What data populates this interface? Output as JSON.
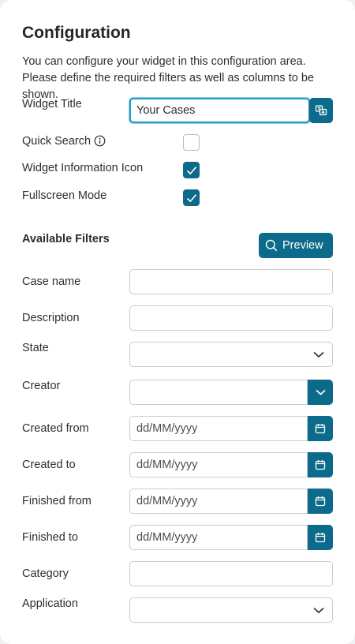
{
  "header": {
    "title": "Configuration",
    "description": "You can configure your widget in this configuration area. Please define the required filters as well as columns to be shown."
  },
  "settings": {
    "widget_title_label": "Widget Title",
    "widget_title_value": "Your Cases",
    "quick_search_label": "Quick Search",
    "quick_search_checked": false,
    "info_icon_label": "Widget Information Icon",
    "info_icon_checked": true,
    "fullscreen_label": "Fullscreen Mode",
    "fullscreen_checked": true
  },
  "filters": {
    "heading": "Available Filters",
    "preview_label": "Preview",
    "case_name_label": "Case name",
    "description_label": "Description",
    "state_label": "State",
    "creator_label": "Creator",
    "created_from_label": "Created from",
    "created_from_placeholder": "dd/MM/yyyy",
    "created_to_label": "Created to",
    "created_to_placeholder": "dd/MM/yyyy",
    "finished_from_label": "Finished from",
    "finished_from_placeholder": "dd/MM/yyyy",
    "finished_to_label": "Finished to",
    "finished_to_placeholder": "dd/MM/yyyy",
    "category_label": "Category",
    "application_label": "Application"
  },
  "colors": {
    "primary": "#0c6a8a",
    "focus": "#1d9bc2"
  },
  "icons": {
    "translate": "translate-icon",
    "info": "info-icon",
    "search": "search-icon",
    "chevron": "chevron-down-icon",
    "calendar": "calendar-icon",
    "check": "check-icon"
  }
}
